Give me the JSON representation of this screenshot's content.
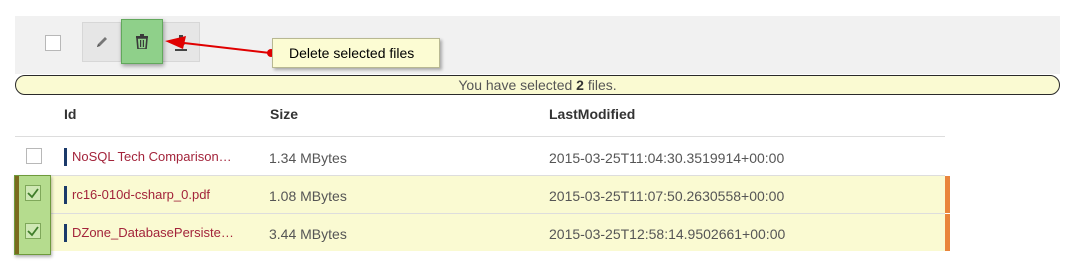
{
  "toolbar": {
    "edit_icon": "pencil-icon",
    "delete_icon": "trash-icon",
    "download_icon": "download-icon"
  },
  "tooltip": {
    "text": "Delete selected files"
  },
  "banner": {
    "prefix": "You have selected ",
    "count": "2",
    "suffix": " files."
  },
  "table": {
    "headers": {
      "id": "Id",
      "size": "Size",
      "modified": "LastModified"
    },
    "rows": [
      {
        "id": "NoSQL Tech Comparison…",
        "size": "1.34 MBytes",
        "modified": "2015-03-25T11:04:30.3519914+00:00",
        "selected": false
      },
      {
        "id": "rc16-010d-csharp_0.pdf",
        "size": "1.08 MBytes",
        "modified": "2015-03-25T11:07:50.2630558+00:00",
        "selected": true
      },
      {
        "id": "DZone_DatabasePersiste…",
        "size": "3.44 MBytes",
        "modified": "2015-03-25T12:58:14.9502661+00:00",
        "selected": true
      }
    ]
  },
  "colors": {
    "accent_red": "#e00000",
    "selected_bg": "#fafad2",
    "row_edge": "#e9853c",
    "id_text": "#a3243b"
  }
}
